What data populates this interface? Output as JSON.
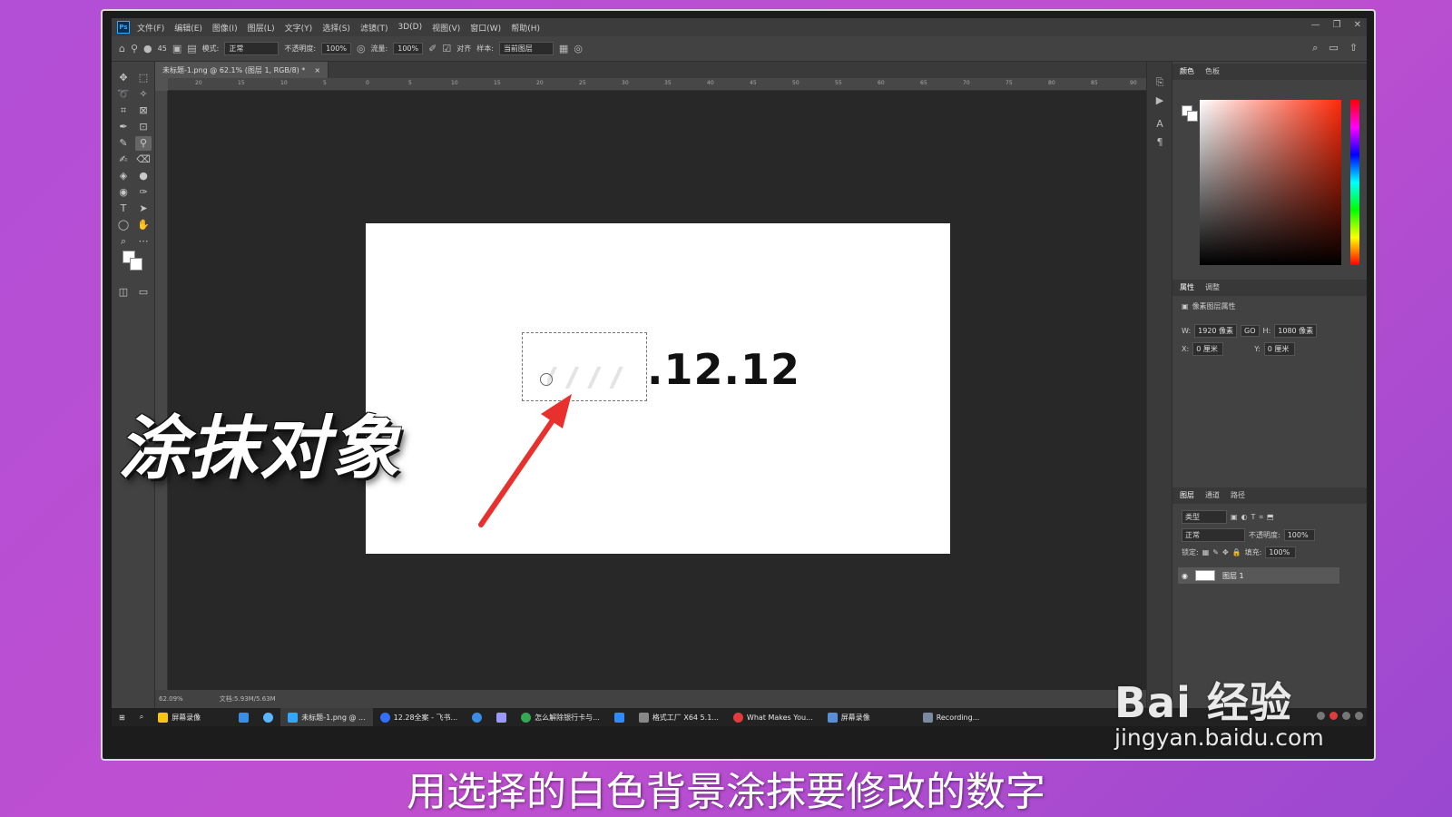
{
  "menubar": {
    "app_icon": "Ps",
    "items": [
      "文件(F)",
      "编辑(E)",
      "图像(I)",
      "图层(L)",
      "文字(Y)",
      "选择(S)",
      "滤镜(T)",
      "3D(D)",
      "视图(V)",
      "窗口(W)",
      "帮助(H)"
    ],
    "window_controls": [
      "—",
      "❐",
      "✕"
    ]
  },
  "options_bar": {
    "brush_size": "45",
    "mode_label": "模式:",
    "mode_value": "正常",
    "opacity_label": "不透明度:",
    "opacity_value": "100%",
    "flow_label": "流量:",
    "flow_value": "100%",
    "align_label": "对齐",
    "sample_label": "样本:",
    "sample_value": "当前图层"
  },
  "document": {
    "tab_title": "未标题-1.png @ 62.1% (图层 1, RGB/8) *",
    "tab_close": "×",
    "visible_number": ".12.12"
  },
  "ruler_ticks": [
    "20",
    "15",
    "10",
    "5",
    "0",
    "5",
    "10",
    "15",
    "20",
    "25",
    "30",
    "35",
    "40",
    "45",
    "50",
    "55",
    "60",
    "65",
    "70",
    "75",
    "80",
    "85",
    "90"
  ],
  "status_bar": {
    "zoom": "62.09%",
    "doc_info": "文档:5.93M/5.63M"
  },
  "panels": {
    "color_tabs": [
      "颜色",
      "色板"
    ],
    "properties_tabs": [
      "属性",
      "调整"
    ],
    "properties_title": "像素图层属性",
    "w_label": "W:",
    "w_value": "1920 像素",
    "link_label": "GO",
    "h_label": "H:",
    "h_value": "1080 像素",
    "x_label": "X:",
    "x_value": "0 厘米",
    "y_label": "Y:",
    "y_value": "0 厘米",
    "layer_tabs": [
      "图层",
      "通道",
      "路径"
    ],
    "layer_filter": "类型",
    "blend_mode": "正常",
    "opacity_label": "不透明度:",
    "opacity_value": "100%",
    "lock_label": "锁定:",
    "fill_label": "填充:",
    "fill_value": "100%",
    "layer_name": "图层 1"
  },
  "taskbar": {
    "items": [
      {
        "label": "屏幕录像",
        "color": "#f5c518"
      },
      {
        "label": "",
        "color": "#3a8ee6"
      },
      {
        "label": "",
        "color": "#5bb5ff"
      },
      {
        "label": "未标题-1.png @ ...",
        "color": "#31a8ff"
      },
      {
        "label": "12.28全案 - 飞书...",
        "color": "#3370ff"
      },
      {
        "label": "",
        "color": "#3a8ee6"
      },
      {
        "label": "",
        "color": "#9999ff"
      },
      {
        "label": "怎么解除银行卡与...",
        "color": "#34a853"
      },
      {
        "label": "",
        "color": "#2f8cff"
      },
      {
        "label": "格式工厂 X64 5.1...",
        "color": "#888888"
      },
      {
        "label": "What Makes You...",
        "color": "#e23b3b"
      },
      {
        "label": "屏幕录像",
        "color": "#5a8fd6"
      },
      {
        "label": "Recording...",
        "color": "#7a8aa0"
      }
    ]
  },
  "overlay": {
    "title": "涂抹对象",
    "subtitle": "用选择的白色背景涂抹要修改的数字"
  },
  "watermark": {
    "logo": "Bai 经验",
    "url": "jingyan.baidu.com"
  },
  "colors": {
    "accent_arrow": "#e8312c",
    "background": "#b24fd6"
  }
}
